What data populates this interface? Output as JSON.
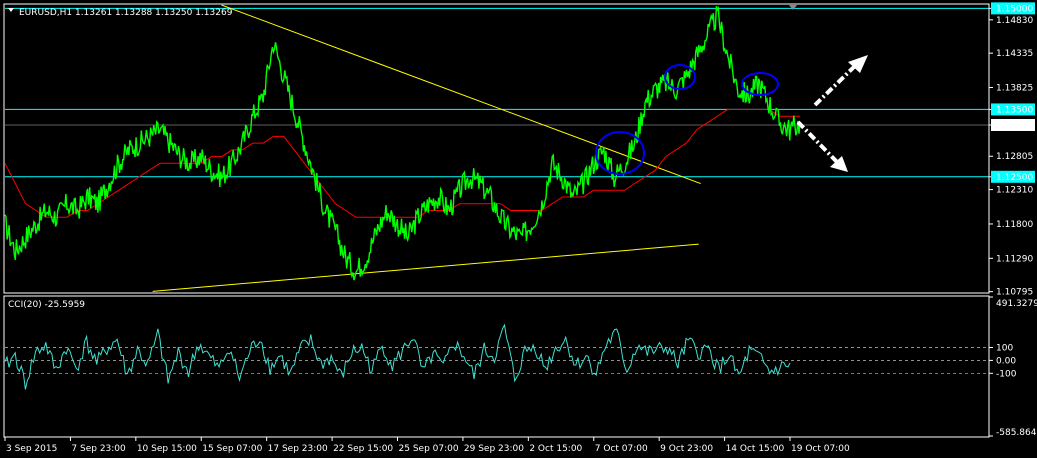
{
  "header": {
    "symbol_line": "EURUSD,H1  1.13261 1.13288 1.13250 1.13269",
    "indicator_line": "CCI(20) -25.5959"
  },
  "colors": {
    "background": "#000000",
    "price": "#00ff00",
    "ma": "#ff0000",
    "trendline": "#ffff00",
    "hline": "#00ffff",
    "cci": "#40e0d0",
    "circle": "#0000ff",
    "arrow": "#ffffff",
    "tag_bg": "#00ffff"
  },
  "chart_data": [
    {
      "type": "line",
      "name": "price",
      "y_ticks": [
        "1.15000",
        "1.14830",
        "1.14335",
        "1.13825",
        "1.13500",
        "1.13269",
        "1.12805",
        "1.12500",
        "1.12310",
        "1.11800",
        "1.11290",
        "1.10795"
      ],
      "ylim": [
        1.1079,
        1.1505
      ],
      "x_tick_labels": [
        "3 Sep 2015",
        "7 Sep 23:00",
        "10 Sep 15:00",
        "15 Sep 07:00",
        "17 Sep 23:00",
        "22 Sep 15:00",
        "25 Sep 07:00",
        "29 Sep 23:00",
        "2 Oct 15:00",
        "7 Oct 07:00",
        "9 Oct 23:00",
        "14 Oct 15:00",
        "19 Oct 07:00"
      ],
      "horizontal_levels": [
        1.15,
        1.135,
        1.125
      ],
      "highlighted_levels": [
        "1.15000",
        "1.13500",
        "1.12500"
      ],
      "current_price": "1.13269",
      "price_series": [
        1.118,
        1.114,
        1.116,
        1.118,
        1.12,
        1.119,
        1.121,
        1.12,
        1.122,
        1.121,
        1.124,
        1.127,
        1.129,
        1.13,
        1.131,
        1.132,
        1.13,
        1.128,
        1.127,
        1.128,
        1.126,
        1.125,
        1.127,
        1.13,
        1.134,
        1.137,
        1.145,
        1.14,
        1.135,
        1.13,
        1.125,
        1.12,
        1.117,
        1.113,
        1.111,
        1.113,
        1.117,
        1.12,
        1.118,
        1.116,
        1.119,
        1.121,
        1.122,
        1.12,
        1.123,
        1.125,
        1.124,
        1.122,
        1.119,
        1.117,
        1.116,
        1.118,
        1.121,
        1.127,
        1.125,
        1.122,
        1.124,
        1.127,
        1.129,
        1.125,
        1.127,
        1.13,
        1.136,
        1.138,
        1.139,
        1.138,
        1.14,
        1.143,
        1.146,
        1.149,
        1.143,
        1.138,
        1.137,
        1.139,
        1.136,
        1.133,
        1.132,
        1.133
      ],
      "ma_series": [
        1.127,
        1.124,
        1.121,
        1.12,
        1.119,
        1.119,
        1.119,
        1.12,
        1.12,
        1.121,
        1.122,
        1.123,
        1.124,
        1.125,
        1.126,
        1.127,
        1.127,
        1.127,
        1.127,
        1.127,
        1.128,
        1.128,
        1.129,
        1.129,
        1.13,
        1.13,
        1.131,
        1.131,
        1.129,
        1.127,
        1.125,
        1.123,
        1.121,
        1.12,
        1.119,
        1.119,
        1.119,
        1.119,
        1.119,
        1.119,
        1.119,
        1.12,
        1.12,
        1.12,
        1.121,
        1.121,
        1.121,
        1.121,
        1.121,
        1.12,
        1.12,
        1.12,
        1.12,
        1.121,
        1.122,
        1.122,
        1.122,
        1.123,
        1.123,
        1.123,
        1.123,
        1.124,
        1.125,
        1.126,
        1.128,
        1.129,
        1.13,
        1.132,
        1.133,
        1.134,
        1.135,
        1.135,
        1.135,
        1.135,
        1.135,
        1.134,
        1.134,
        1.134
      ],
      "trendlines": [
        {
          "from_pos": 0.22,
          "from": 1.1505,
          "to_pos": 0.707,
          "to": 1.124
        },
        {
          "from_pos": 0.15,
          "from": 1.108,
          "to_pos": 0.705,
          "to": 1.115
        }
      ]
    },
    {
      "type": "line",
      "name": "cci",
      "y_ticks": [
        "491.3279",
        "100",
        "0.00",
        "-100",
        "-585.8642"
      ],
      "ylim": [
        -585.8642,
        491.3279
      ],
      "levels": [
        100,
        0,
        -100
      ],
      "values": [
        -50,
        40,
        -180,
        60,
        120,
        -80,
        100,
        -60,
        140,
        -20,
        90,
        160,
        -120,
        80,
        -40,
        200,
        -160,
        60,
        -90,
        130,
        30,
        -70,
        110,
        -140,
        70,
        180,
        -60,
        40,
        -110,
        90,
        150,
        -30,
        20,
        -130,
        60,
        100,
        -80,
        120,
        -40,
        70,
        190,
        -100,
        50,
        -60,
        140,
        40,
        -120,
        80,
        30,
        250,
        -150,
        70,
        110,
        -60,
        90,
        160,
        -40,
        30,
        -100,
        130,
        210,
        -80,
        120,
        60,
        80,
        100,
        -30,
        150,
        60,
        90,
        -70,
        40,
        -130,
        70,
        20,
        -90,
        -60,
        -20
      ]
    }
  ]
}
